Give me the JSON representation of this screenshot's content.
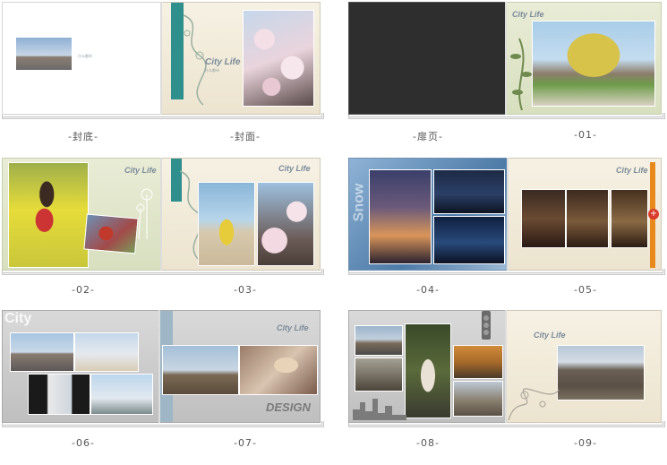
{
  "captions": {
    "back_cover": "-封底-",
    "front_cover": "-封面-",
    "title_page": "-扉页-",
    "p01": "-01-",
    "p02": "-02-",
    "p03": "-03-",
    "p04": "-04-",
    "p05": "-05-",
    "p06": "-06-",
    "p07": "-07-",
    "p08": "-08-",
    "p09": "-09-"
  },
  "brand": {
    "title": "City Life",
    "subtitle": "什么都市"
  },
  "decor_text": {
    "city": "City",
    "design": "DESIGN",
    "snow": "Snow"
  },
  "colors": {
    "teal_ribbon": "#2f8f8c",
    "dark_page": "#2e2e2e",
    "cream": "#f3eedf",
    "green": "#dfe5c6",
    "gray": "#cfcfcf",
    "orange_accent": "#e8891c"
  }
}
